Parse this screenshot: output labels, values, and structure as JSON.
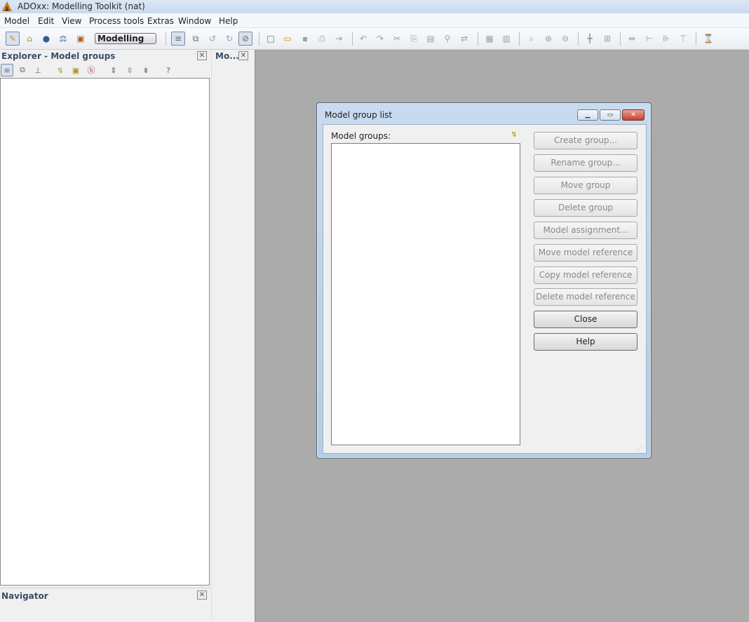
{
  "window": {
    "title": "ADOxx: Modelling Toolkit (nat)"
  },
  "menu": [
    "Model",
    "Edit",
    "View",
    "Process tools",
    "Extras",
    "Window",
    "Help"
  ],
  "toolbar": {
    "mode_label": "Modelling"
  },
  "explorer": {
    "title": "Explorer - Model groups",
    "close_glyph": "✕"
  },
  "model_panel": {
    "title": "Mo...",
    "close_glyph": "✕"
  },
  "navigator": {
    "title": "Navigator",
    "close_glyph": "✕"
  },
  "dialog": {
    "title": "Model group list",
    "list_label": "Model groups:",
    "buttons": {
      "create": "Create group...",
      "rename": "Rename group...",
      "move": "Move group",
      "delete": "Delete group",
      "assign": "Model assignment...",
      "move_ref": "Move model reference",
      "copy_ref": "Copy model reference",
      "delete_ref": "Delete model reference",
      "close": "Close",
      "help": "Help"
    }
  }
}
